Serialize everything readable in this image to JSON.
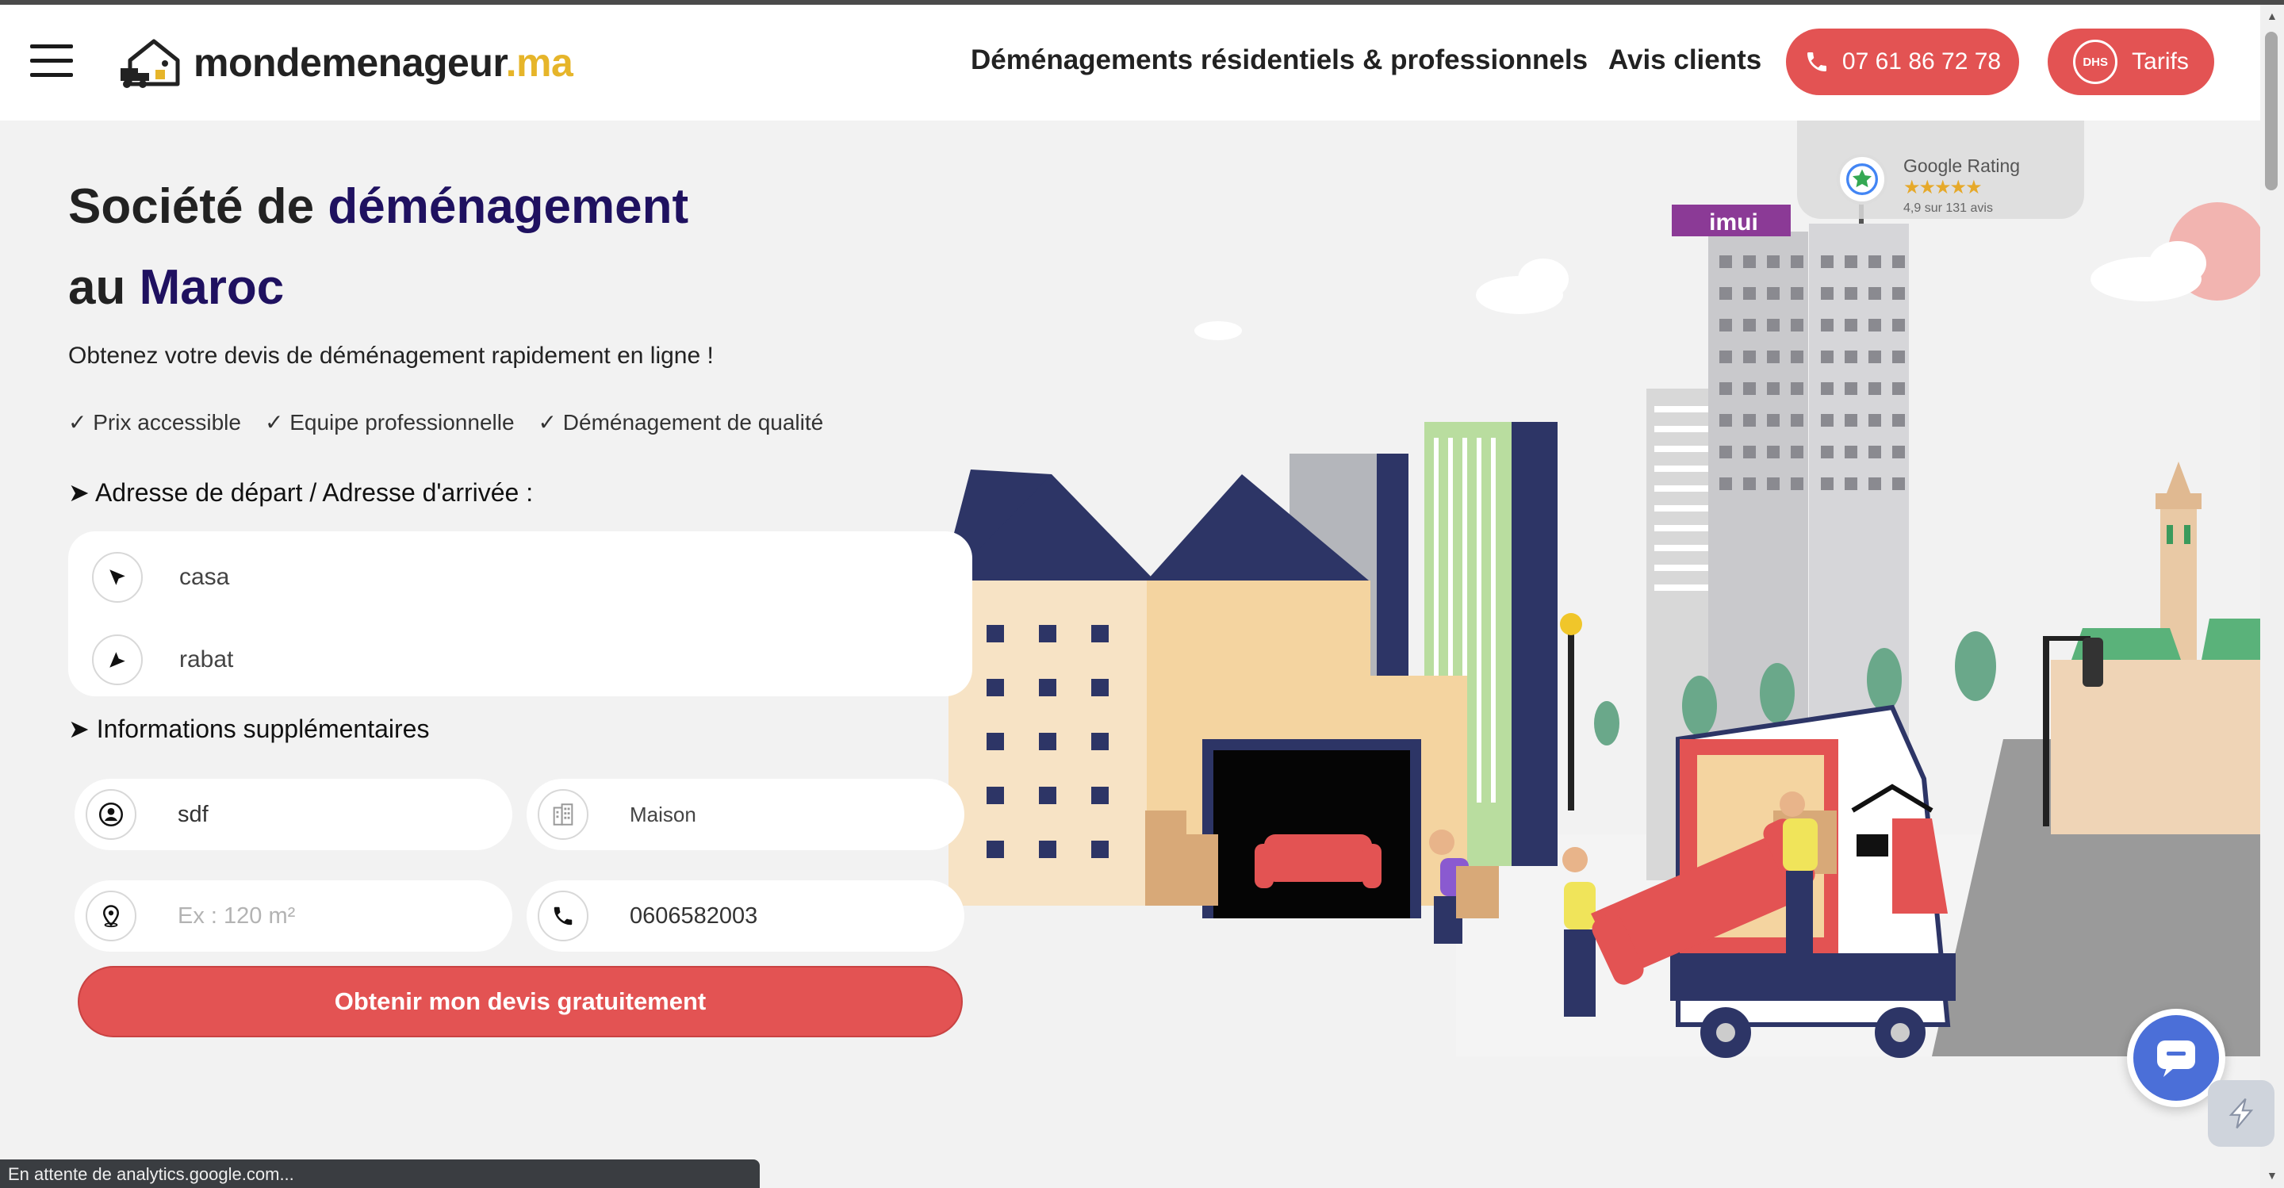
{
  "header": {
    "logo_name": "mondemenageur",
    "logo_tld": ".ma",
    "nav": {
      "services": "Déménagements résidentiels & professionnels",
      "reviews": "Avis clients"
    },
    "phone": "07 61 86 72 78",
    "tarifs_badge": "DHS",
    "tarifs": "Tarifs"
  },
  "hero": {
    "title_1": "Société de ",
    "title_1_bold": "déménagement",
    "title_2": "au ",
    "title_2_bold": "Maroc",
    "subtitle": "Obtenez votre devis de déménagement rapidement en ligne !",
    "checks": [
      "✓ Prix accessible",
      "✓ Equipe professionnelle",
      "✓ Déménagement de qualité"
    ]
  },
  "form": {
    "address_label": "➤ Adresse de départ / Adresse d'arrivée :",
    "departure": "casa",
    "arrival": "rabat",
    "extra_label": "➤ Informations supplémentaires",
    "name": "sdf",
    "housing_type": "Maison",
    "surface_placeholder": "Ex : 120 m²",
    "phone": "0606582003",
    "submit": "Obtenir mon devis gratuitement"
  },
  "rating": {
    "label": "Google Rating",
    "stars": "★★★★★",
    "summary": "4,9 sur 131 avis"
  },
  "illustration": {
    "building_sign": "imui"
  },
  "status_bar": "En attente de analytics.google.com...",
  "colors": {
    "accent": "#e35353",
    "brand_dark": "#1f1160",
    "logo_tld": "#e6b52a"
  }
}
